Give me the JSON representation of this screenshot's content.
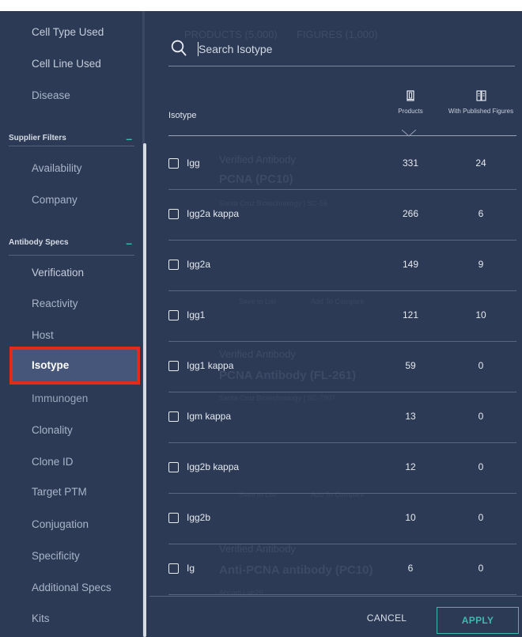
{
  "sidebar": {
    "items_top": [
      "Cell Type Used",
      "Cell Line Used",
      "Disease"
    ],
    "supplier_header": "Supplier Filters",
    "supplier_items": [
      "Availability",
      "Company"
    ],
    "antibody_header": "Antibody Specs",
    "antibody_items": [
      "Verification",
      "Reactivity",
      "Host",
      "Isotype",
      "Immunogen",
      "Clonality",
      "Clone ID",
      "Target PTM",
      "Conjugation",
      "Specificity",
      "Additional Specs",
      "Kits"
    ],
    "selected": "Isotype",
    "collapse_glyph": "–"
  },
  "background": {
    "tabs": [
      "PRODUCTS (5,000)",
      "FIGURES (1,000)"
    ],
    "verified": [
      "Verified Antibody",
      "Verified Antibody",
      "Verified Antibody"
    ],
    "titles": [
      "PCNA (PC10)",
      "PCNA Antibody (FL-261)",
      "Anti-PCNA antibody (PC10)"
    ],
    "suppliers": [
      "Santa Cruz Biotechnology | SC-56",
      "Santa Cruz Biotechnology | SC-7907",
      "Abcam | ab29"
    ],
    "save_to_list": "Save to List",
    "add_to_compare": "Add To Compare"
  },
  "search": {
    "placeholder": "Search Isotype"
  },
  "table": {
    "header": {
      "isotype": "Isotype",
      "products": "Products",
      "published": "With Published Figures"
    },
    "rows": [
      {
        "name": "Igg",
        "products": "331",
        "published": "24"
      },
      {
        "name": "Igg2a kappa",
        "products": "266",
        "published": "6"
      },
      {
        "name": "Igg2a",
        "products": "149",
        "published": "9"
      },
      {
        "name": "Igg1",
        "products": "121",
        "published": "10"
      },
      {
        "name": "Igg1 kappa",
        "products": "59",
        "published": "0"
      },
      {
        "name": "Igm kappa",
        "products": "13",
        "published": "0"
      },
      {
        "name": "Igg2b kappa",
        "products": "12",
        "published": "0"
      },
      {
        "name": "Igg2b",
        "products": "10",
        "published": "0"
      },
      {
        "name": "Ig",
        "products": "6",
        "published": "0"
      }
    ]
  },
  "footer": {
    "cancel": "CANCEL",
    "apply": "APPLY"
  },
  "colors": {
    "background": "#2c3a56",
    "accent": "#3fb9b0",
    "highlight_border": "#e32b1a",
    "selected_bg": "#46567a"
  },
  "icons": [
    "search-icon",
    "products-column-icon",
    "published-figures-column-icon",
    "sort-chevron-icon"
  ]
}
